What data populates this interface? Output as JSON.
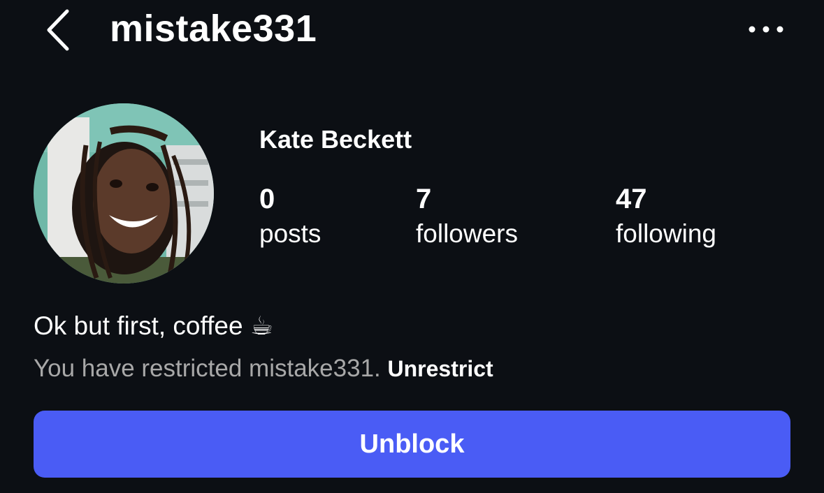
{
  "header": {
    "back_icon": "chevron-left-icon",
    "username": "mistake331",
    "more_icon": "more-horizontal-icon"
  },
  "profile": {
    "avatar_alt": "profile photo",
    "display_name": "Kate Beckett",
    "stats": [
      {
        "value": "0",
        "label": "posts"
      },
      {
        "value": "7",
        "label": "followers"
      },
      {
        "value": "47",
        "label": "following"
      }
    ],
    "bio": "Ok but first, coffee ☕",
    "restrict_notice": "You have restricted mistake331.",
    "unrestrict_label": "Unrestrict"
  },
  "actions": {
    "unblock_label": "Unblock"
  },
  "colors": {
    "background": "#0c0f14",
    "primary_button": "#4a5cf5",
    "muted_text": "#a8a8a8",
    "text": "#ffffff"
  }
}
